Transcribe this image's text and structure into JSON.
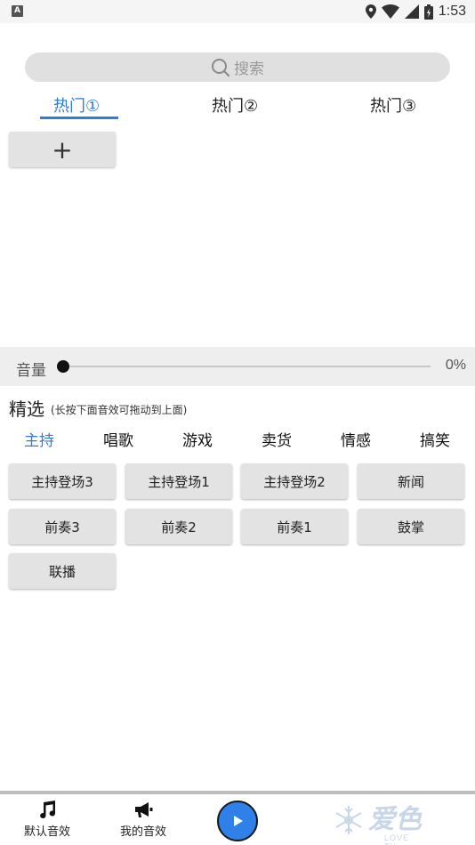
{
  "status_bar": {
    "left_badge": "A",
    "time": "1:53"
  },
  "search": {
    "placeholder": "搜索"
  },
  "hot_tabs": [
    {
      "label": "热门①",
      "active": true
    },
    {
      "label": "热门②",
      "active": false
    },
    {
      "label": "热门③",
      "active": false
    }
  ],
  "add_button": {
    "label": "+"
  },
  "volume": {
    "label": "音量",
    "value": "0%",
    "level": 0
  },
  "featured": {
    "title": "精选",
    "hint": "(长按下面音效可拖动到上面)"
  },
  "category_tabs": [
    {
      "label": "主持",
      "active": true
    },
    {
      "label": "唱歌",
      "active": false
    },
    {
      "label": "游戏",
      "active": false
    },
    {
      "label": "卖货",
      "active": false
    },
    {
      "label": "情感",
      "active": false
    },
    {
      "label": "搞笑",
      "active": false
    }
  ],
  "effects": [
    "主持登场3",
    "主持登场1",
    "主持登场2",
    "新闻",
    "前奏3",
    "前奏2",
    "前奏1",
    "鼓掌",
    "联播"
  ],
  "bottom_nav": {
    "default_label": "默认音效",
    "mine_label": "我的音效",
    "brand_text": "爱色",
    "brand_sub": "LOVE TV"
  },
  "colors": {
    "accent": "#2d7be0",
    "play": "#2f80e8"
  },
  "icons": {
    "status": [
      "location-icon",
      "wifi-icon",
      "signal-icon",
      "battery-icon"
    ],
    "search": "search-icon",
    "default_nav": "music-note-icon",
    "mine_nav": "megaphone-icon",
    "play": "play-icon",
    "brand": "snowflake-icon"
  }
}
